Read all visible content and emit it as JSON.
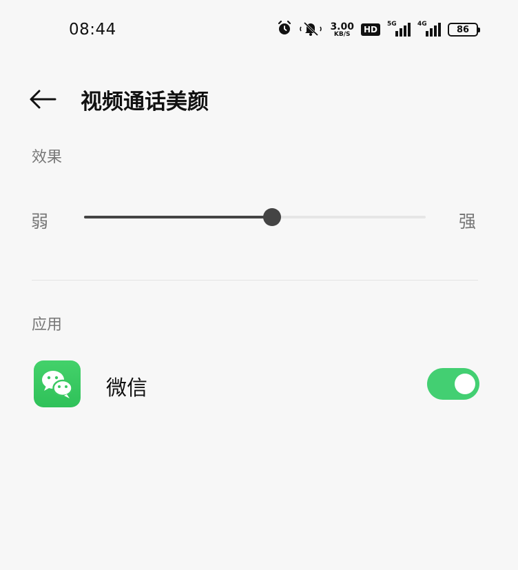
{
  "status_bar": {
    "time": "08:44",
    "speed_value": "3.00",
    "speed_unit": "KB/S",
    "hd": "HD",
    "sim1_tag": "5G",
    "sim2_tag": "4G",
    "battery": "86"
  },
  "header": {
    "title": "视频通话美颜"
  },
  "effect": {
    "section_label": "效果",
    "min_label": "弱",
    "max_label": "强",
    "level_fraction": 0.55
  },
  "apps": {
    "section_label": "应用",
    "items": [
      {
        "name": "微信",
        "enabled": true,
        "icon": "wechat-icon"
      }
    ]
  },
  "colors": {
    "toggle_on": "#43cf72",
    "wechat_green": "#3ac862",
    "slider_active": "#444444"
  }
}
